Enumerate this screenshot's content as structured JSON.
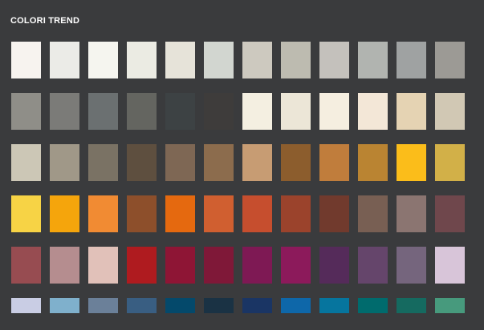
{
  "header": {
    "title": "COLORI TREND"
  },
  "palette": {
    "rows": [
      [
        "#f7f3ef",
        "#ebebe7",
        "#f5f5ef",
        "#ebebe3",
        "#e6e3d9",
        "#d2d6d0",
        "#cdc9bf",
        "#bdbbb0",
        "#c4c1bc",
        "#b1b4b0",
        "#9fa2a2",
        "#9c9a95"
      ],
      [
        "#8f8e88",
        "#7b7b78",
        "#6b7071",
        "#646560",
        "#3d4244",
        "#3e3c3b",
        "#f4efe1",
        "#ece6d7",
        "#f5eee0",
        "#f3e7d7",
        "#e5d3b3",
        "#d1c8b4"
      ],
      [
        "#ccc7b6",
        "#a09888",
        "#7a7264",
        "#5e4f3f",
        "#7e6754",
        "#8c6c4d",
        "#c79c73",
        "#8c5d2d",
        "#c07d3c",
        "#ba8432",
        "#fbbd1a",
        "#d2b048"
      ],
      [
        "#f7d345",
        "#f5a50c",
        "#f18b33",
        "#8d4f2b",
        "#e5690f",
        "#d05f30",
        "#c64e2e",
        "#9b432c",
        "#713a2d",
        "#785f53",
        "#8b7571",
        "#6f474c"
      ],
      [
        "#974c51",
        "#b58d8f",
        "#e1c1b9",
        "#af1b1f",
        "#8e1535",
        "#7f1838",
        "#7e1954",
        "#8c1a5b",
        "#552b5a",
        "#65456b",
        "#75657d",
        "#d8c5d9"
      ],
      [
        "#c9cde4",
        "#7fb0cc",
        "#6b8099",
        "#395e82",
        "#04496b",
        "#1a3244",
        "#1a3564",
        "#0e67a9",
        "#06759e",
        "#006b6d",
        "#156a60",
        "#479a7d"
      ]
    ]
  }
}
